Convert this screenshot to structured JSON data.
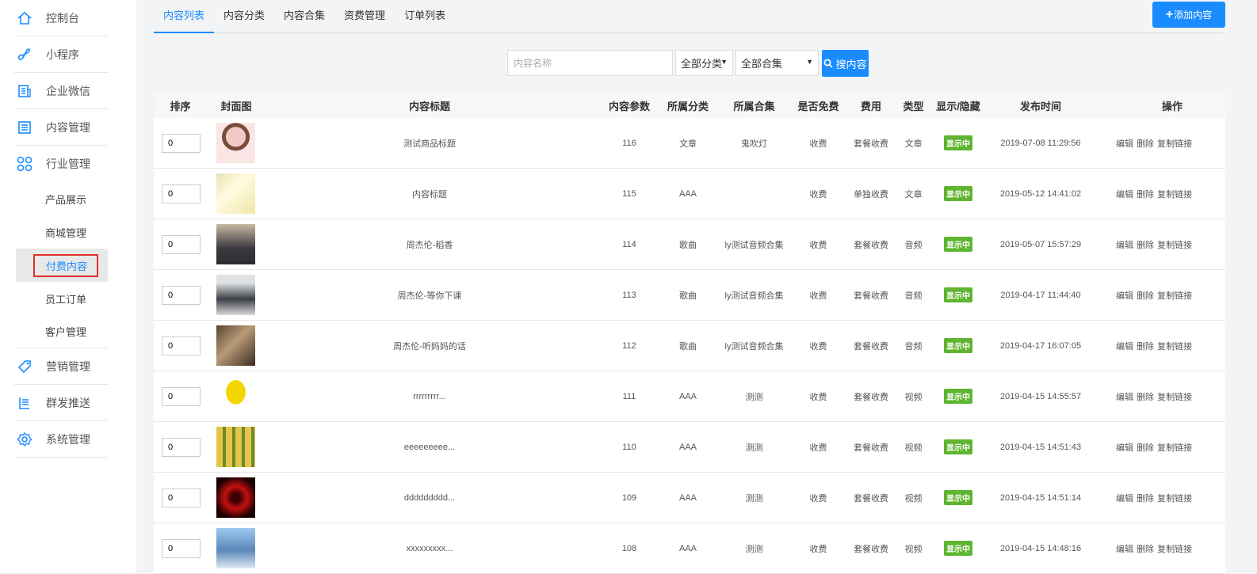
{
  "sidebar": {
    "items": [
      {
        "label": "控制台",
        "icon": "home-icon"
      },
      {
        "label": "小程序",
        "icon": "link-icon"
      },
      {
        "label": "企业微信",
        "icon": "building-icon"
      },
      {
        "label": "内容管理",
        "icon": "document-icon"
      },
      {
        "label": "行业管理",
        "icon": "grid-icon"
      }
    ],
    "subitems": [
      {
        "label": "产品展示"
      },
      {
        "label": "商城管理"
      },
      {
        "label": "付费内容",
        "active": true
      },
      {
        "label": "员工订单"
      },
      {
        "label": "客户管理"
      }
    ],
    "bottom_items": [
      {
        "label": "营销管理",
        "icon": "tag-icon"
      },
      {
        "label": "群发推送",
        "icon": "broadcast-icon"
      },
      {
        "label": "系统管理",
        "icon": "gear-icon"
      }
    ]
  },
  "tabs": [
    {
      "label": "内容列表",
      "active": true
    },
    {
      "label": "内容分类"
    },
    {
      "label": "内容合集"
    },
    {
      "label": "资费管理"
    },
    {
      "label": "订单列表"
    }
  ],
  "add_button": "添加内容",
  "search": {
    "placeholder": "内容名称",
    "category_select": "全部分类",
    "collection_select": "全部合集",
    "button": "搜内容"
  },
  "table": {
    "headers": [
      "排序",
      "封面图",
      "内容标题",
      "内容参数",
      "所属分类",
      "所属合集",
      "是否免费",
      "费用",
      "类型",
      "显示/隐藏",
      "发布时间",
      "操作"
    ],
    "rows": [
      {
        "sort": "0",
        "title": "测试商品标题",
        "param": "116",
        "category": "文章",
        "collection": "鬼吹灯",
        "free": "收费",
        "fee": "套餐收费",
        "type": "文章",
        "status": "显示中",
        "time": "2019-07-08 11:29:56"
      },
      {
        "sort": "0",
        "title": "内容标题",
        "param": "115",
        "category": "AAA",
        "collection": "",
        "free": "收费",
        "fee": "单独收费",
        "type": "文章",
        "status": "显示中",
        "time": "2019-05-12 14:41:02"
      },
      {
        "sort": "0",
        "title": "周杰伦-稻香",
        "param": "114",
        "category": "歌曲",
        "collection": "ly测试音频合集",
        "free": "收费",
        "fee": "套餐收费",
        "type": "音频",
        "status": "显示中",
        "time": "2019-05-07 15:57:29"
      },
      {
        "sort": "0",
        "title": "周杰伦-等你下课",
        "param": "113",
        "category": "歌曲",
        "collection": "ly测试音频合集",
        "free": "收费",
        "fee": "套餐收费",
        "type": "音频",
        "status": "显示中",
        "time": "2019-04-17 11:44:40"
      },
      {
        "sort": "0",
        "title": "周杰伦-听妈妈的话",
        "param": "112",
        "category": "歌曲",
        "collection": "ly测试音频合集",
        "free": "收费",
        "fee": "套餐收费",
        "type": "音频",
        "status": "显示中",
        "time": "2019-04-17 16:07:05"
      },
      {
        "sort": "0",
        "title": "rrrrrrrrr...",
        "param": "111",
        "category": "AAA",
        "collection": "测测",
        "free": "收费",
        "fee": "套餐收费",
        "type": "视频",
        "status": "显示中",
        "time": "2019-04-15 14:55:57"
      },
      {
        "sort": "0",
        "title": "eeeeeeeee...",
        "param": "110",
        "category": "AAA",
        "collection": "测测",
        "free": "收费",
        "fee": "套餐收费",
        "type": "视频",
        "status": "显示中",
        "time": "2019-04-15 14:51:43"
      },
      {
        "sort": "0",
        "title": "ddddddddd...",
        "param": "109",
        "category": "AAA",
        "collection": "测测",
        "free": "收费",
        "fee": "套餐收费",
        "type": "视频",
        "status": "显示中",
        "time": "2019-04-15 14:51:14"
      },
      {
        "sort": "0",
        "title": "xxxxxxxxx...",
        "param": "108",
        "category": "AAA",
        "collection": "测测",
        "free": "收费",
        "fee": "套餐收费",
        "type": "视频",
        "status": "显示中",
        "time": "2019-04-15 14:48:16"
      }
    ],
    "actions": {
      "edit": "编辑",
      "delete": "删除",
      "copy": "复制链接"
    }
  },
  "colors": {
    "accent": "#1a8cff",
    "status": "#5fb430",
    "highlight_border": "#e0302a"
  }
}
